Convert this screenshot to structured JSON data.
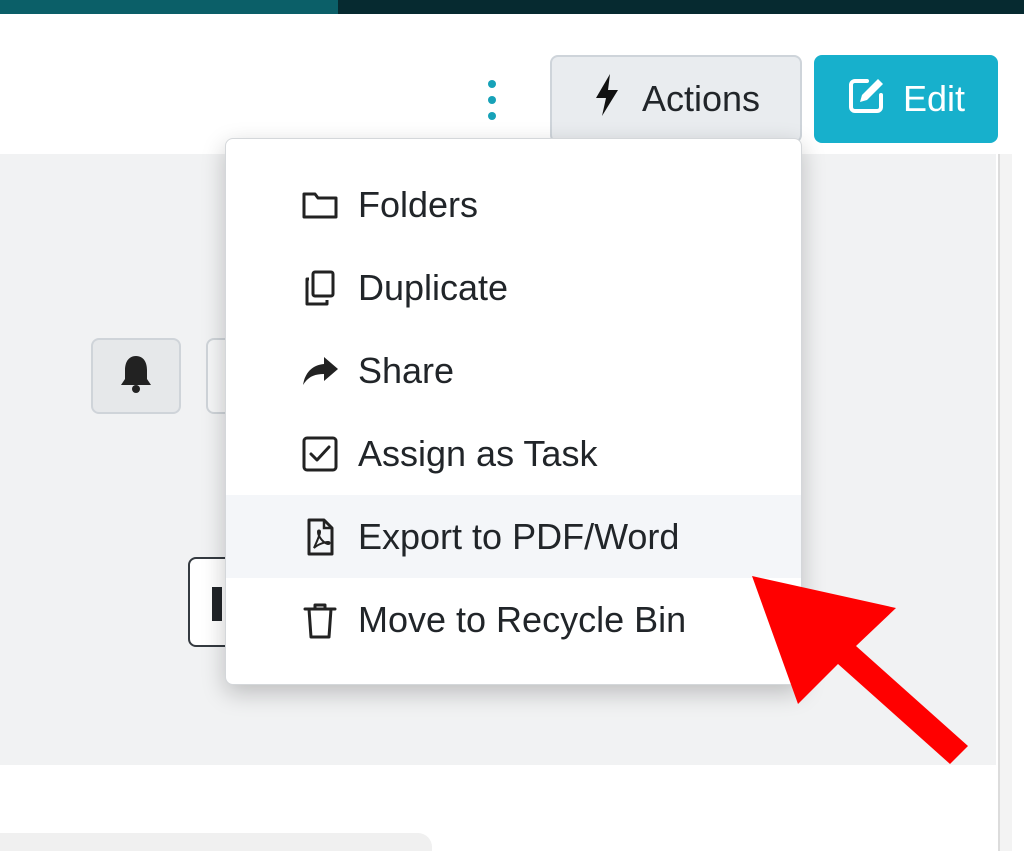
{
  "topbar": {
    "progress_percent": 33
  },
  "header": {
    "actions_label": "Actions",
    "edit_label": "Edit",
    "actions_icon": "bolt-icon",
    "edit_icon": "edit-icon",
    "kebab_icon": "vertical-dots-icon"
  },
  "colors": {
    "topbar_dark": "#062a30",
    "topbar_progress": "#0b5f68",
    "accent": "#17b0cc",
    "kebab": "#17a2b8",
    "annotation_arrow": "#ff0000",
    "hover_bg": "#f4f6f9"
  },
  "dropdown": {
    "items": [
      {
        "label": "Folders",
        "icon": "folder-icon"
      },
      {
        "label": "Duplicate",
        "icon": "copy-icon"
      },
      {
        "label": "Share",
        "icon": "share-icon"
      },
      {
        "label": "Assign as Task",
        "icon": "checkbox-icon"
      },
      {
        "label": "Export to PDF/Word",
        "icon": "pdf-file-icon",
        "highlighted": true
      },
      {
        "label": "Move to Recycle Bin",
        "icon": "trash-icon"
      }
    ]
  },
  "background": {
    "bell_icon": "bell-icon"
  },
  "annotation": {
    "icon": "red-arrow-icon"
  }
}
